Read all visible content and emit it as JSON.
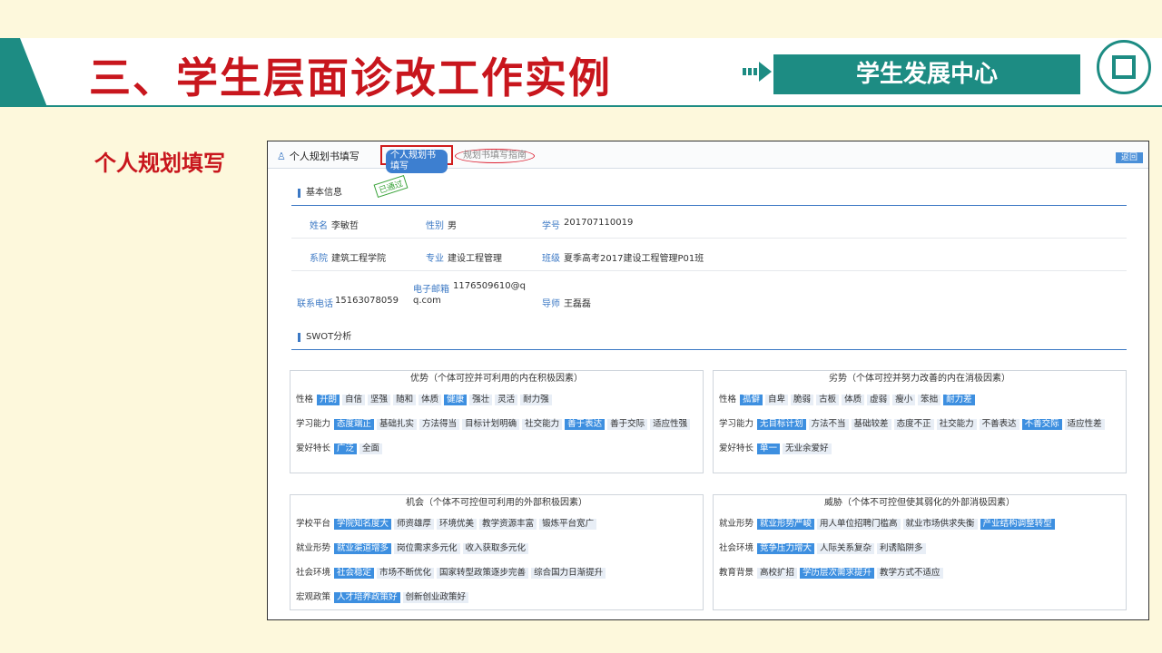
{
  "slide": {
    "title": "三、学生层面诊改工作实例",
    "center_label": "学生发展中心",
    "side_label": "个人规划填写"
  },
  "app": {
    "tab_main": "个人规划书填写",
    "tab_active": "个人规划书填写",
    "tab_guide": "规划书填写指南",
    "back": "返回",
    "stamp": "已通过",
    "section_basic": "基本信息",
    "section_swot": "SWOT分析"
  },
  "basic": {
    "name_l": "姓名",
    "name_v": "李敏哲",
    "gender_l": "性别",
    "gender_v": "男",
    "id_l": "学号",
    "id_v": "201707110019",
    "dept_l": "系院",
    "dept_v": "建筑工程学院",
    "major_l": "专业",
    "major_v": "建设工程管理",
    "class_l": "班级",
    "class_v": "夏季高考2017建设工程管理P01班",
    "phone_l": "联系电话",
    "phone_v": "15163078059",
    "email_l": "电子邮箱",
    "email_v1": "1176509610@q",
    "email_v2": "q.com",
    "tutor_l": "导师",
    "tutor_v": "王磊磊"
  },
  "swot": [
    {
      "title": "优势（个体可控并可利用的内在积极因素）",
      "rows": [
        {
          "label": "性格",
          "tags": [
            [
              "开朗",
              1
            ],
            [
              "自信",
              0
            ],
            [
              "坚强",
              0
            ],
            [
              "随和",
              0
            ],
            [
              "体质",
              0
            ],
            [
              "健康",
              1
            ],
            [
              "强壮",
              0
            ],
            [
              "灵活",
              0
            ],
            [
              "耐力强",
              0
            ]
          ]
        },
        {
          "label": "学习能力",
          "tags": [
            [
              "态度端正",
              1
            ],
            [
              "基础扎实",
              0
            ],
            [
              "方法得当",
              0
            ],
            [
              "目标计划明确",
              0
            ],
            [
              "社交能力",
              0
            ],
            [
              "善于表达",
              1
            ],
            [
              "善于交际",
              0
            ],
            [
              "适应性强",
              0
            ]
          ]
        },
        {
          "label": "爱好特长",
          "tags": [
            [
              "广泛",
              1
            ],
            [
              "全面",
              0
            ]
          ]
        }
      ]
    },
    {
      "title": "劣势（个体可控并努力改善的内在消极因素）",
      "rows": [
        {
          "label": "性格",
          "tags": [
            [
              "孤僻",
              1
            ],
            [
              "自卑",
              0
            ],
            [
              "脆弱",
              0
            ],
            [
              "古板",
              0
            ],
            [
              "体质",
              0
            ],
            [
              "虚弱",
              0
            ],
            [
              "瘦小",
              0
            ],
            [
              "笨拙",
              0
            ],
            [
              "耐力差",
              1
            ]
          ]
        },
        {
          "label": "学习能力",
          "tags": [
            [
              "无目标计划",
              1
            ],
            [
              "方法不当",
              0
            ],
            [
              "基础较差",
              0
            ],
            [
              "态度不正",
              0
            ],
            [
              "社交能力",
              0
            ],
            [
              "不善表达",
              0
            ],
            [
              "不善交际",
              1
            ],
            [
              "适应性差",
              0
            ]
          ]
        },
        {
          "label": "爱好特长",
          "tags": [
            [
              "单一",
              1
            ],
            [
              "无业余爱好",
              0
            ]
          ]
        }
      ]
    },
    {
      "title": "机会（个体不可控但可利用的外部积极因素）",
      "rows": [
        {
          "label": "学校平台",
          "tags": [
            [
              "学院知名度大",
              1
            ],
            [
              "师资雄厚",
              0
            ],
            [
              "环境优美",
              0
            ],
            [
              "教学资源丰富",
              0
            ],
            [
              "锻炼平台宽广",
              0
            ]
          ]
        },
        {
          "label": "就业形势",
          "tags": [
            [
              "就业渠道增多",
              1
            ],
            [
              "岗位需求多元化",
              0
            ],
            [
              "收入获取多元化",
              0
            ]
          ]
        },
        {
          "label": "社会环境",
          "tags": [
            [
              "社会稳定",
              1
            ],
            [
              "市场不断优化",
              0
            ],
            [
              "国家转型政策逐步完善",
              0
            ],
            [
              "综合国力日渐提升",
              0
            ]
          ]
        },
        {
          "label": "宏观政策",
          "tags": [
            [
              "人才培养政策好",
              1
            ],
            [
              "创新创业政策好",
              0
            ]
          ]
        }
      ]
    },
    {
      "title": "威胁（个体不可控但使其弱化的外部消极因素）",
      "rows": [
        {
          "label": "就业形势",
          "tags": [
            [
              "就业形势严峻",
              1
            ],
            [
              "用人单位招聘门槛高",
              0
            ],
            [
              "就业市场供求失衡",
              0
            ],
            [
              "产业结构调整转型",
              1
            ]
          ]
        },
        {
          "label": "社会环境",
          "tags": [
            [
              "竞争压力增大",
              1
            ],
            [
              "人际关系复杂",
              0
            ],
            [
              "利诱陷阱多",
              0
            ]
          ]
        },
        {
          "label": "教育背景",
          "tags": [
            [
              "高校扩招",
              0
            ],
            [
              "学历层次需求提升",
              1
            ],
            [
              "教学方式不适应",
              0
            ]
          ]
        }
      ]
    }
  ]
}
